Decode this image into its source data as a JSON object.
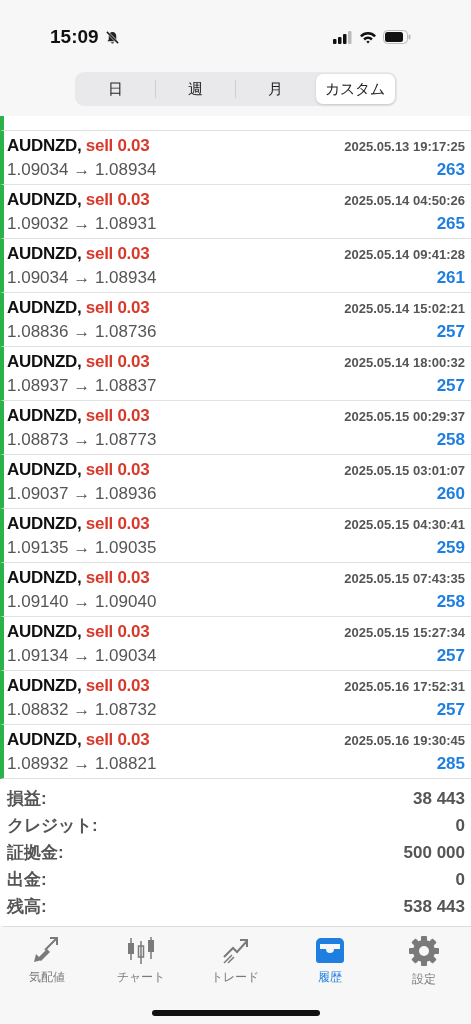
{
  "status_bar": {
    "time": "15:09"
  },
  "tabs": [
    {
      "label": "日",
      "selected": false
    },
    {
      "label": "週",
      "selected": false
    },
    {
      "label": "月",
      "selected": false
    },
    {
      "label": "カスタム",
      "selected": true
    }
  ],
  "deals": [
    {
      "symbol": "AUDNZD,",
      "side": "sell 0.03",
      "time": "2025.05.13 19:17:25",
      "prices": "1.09034 → 1.08934",
      "profit": "263"
    },
    {
      "symbol": "AUDNZD,",
      "side": "sell 0.03",
      "time": "2025.05.14 04:50:26",
      "prices": "1.09032 → 1.08931",
      "profit": "265"
    },
    {
      "symbol": "AUDNZD,",
      "side": "sell 0.03",
      "time": "2025.05.14 09:41:28",
      "prices": "1.09034 → 1.08934",
      "profit": "261"
    },
    {
      "symbol": "AUDNZD,",
      "side": "sell 0.03",
      "time": "2025.05.14 15:02:21",
      "prices": "1.08836 → 1.08736",
      "profit": "257"
    },
    {
      "symbol": "AUDNZD,",
      "side": "sell 0.03",
      "time": "2025.05.14 18:00:32",
      "prices": "1.08937 → 1.08837",
      "profit": "257"
    },
    {
      "symbol": "AUDNZD,",
      "side": "sell 0.03",
      "time": "2025.05.15 00:29:37",
      "prices": "1.08873 → 1.08773",
      "profit": "258"
    },
    {
      "symbol": "AUDNZD,",
      "side": "sell 0.03",
      "time": "2025.05.15 03:01:07",
      "prices": "1.09037 → 1.08936",
      "profit": "260"
    },
    {
      "symbol": "AUDNZD,",
      "side": "sell 0.03",
      "time": "2025.05.15 04:30:41",
      "prices": "1.09135 → 1.09035",
      "profit": "259"
    },
    {
      "symbol": "AUDNZD,",
      "side": "sell 0.03",
      "time": "2025.05.15 07:43:35",
      "prices": "1.09140 → 1.09040",
      "profit": "258"
    },
    {
      "symbol": "AUDNZD,",
      "side": "sell 0.03",
      "time": "2025.05.15 15:27:34",
      "prices": "1.09134 → 1.09034",
      "profit": "257"
    },
    {
      "symbol": "AUDNZD,",
      "side": "sell 0.03",
      "time": "2025.05.16 17:52:31",
      "prices": "1.08832 → 1.08732",
      "profit": "257"
    },
    {
      "symbol": "AUDNZD,",
      "side": "sell 0.03",
      "time": "2025.05.16 19:30:45",
      "prices": "1.08932 → 1.08821",
      "profit": "285"
    }
  ],
  "summary": [
    {
      "label": "損益:",
      "value": "38 443"
    },
    {
      "label": "クレジット:",
      "value": "0"
    },
    {
      "label": "証拠金:",
      "value": "500 000"
    },
    {
      "label": "出金:",
      "value": "0"
    },
    {
      "label": "残高:",
      "value": "538 443"
    }
  ],
  "nav": [
    {
      "kind": "quotes",
      "label": "気配値",
      "selected": false
    },
    {
      "kind": "chart",
      "label": "チャート",
      "selected": false
    },
    {
      "kind": "trade",
      "label": "トレード",
      "selected": false
    },
    {
      "kind": "history",
      "label": "履歴",
      "selected": true
    },
    {
      "kind": "settings",
      "label": "設定",
      "selected": false
    }
  ]
}
